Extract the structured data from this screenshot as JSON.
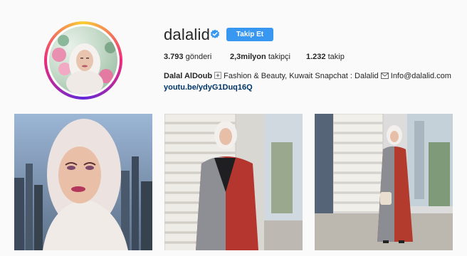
{
  "profile": {
    "username": "dalalid",
    "follow_label": "Takip Et",
    "stats": [
      {
        "count": "3.793",
        "label": "gönderi"
      },
      {
        "count": "2,3milyon",
        "label": "takipçi"
      },
      {
        "count": "1.232",
        "label": "takip"
      }
    ],
    "bio_name": "Dalal AlDoub",
    "bio_part1": " Fashion & Beauty, Kuwait Snapchat : Dalalid ",
    "bio_part2": " Info@dalalid.com",
    "link": "youtu.be/ydyG1Duq16Q"
  },
  "icons": {
    "verified": "verified-badge-icon",
    "bio_icon_1": "sparkle-icon",
    "bio_icon_2": "envelope-icon"
  },
  "colors": {
    "follow_button": "#3897f0",
    "verified": "#3897f0",
    "link": "#003569"
  }
}
